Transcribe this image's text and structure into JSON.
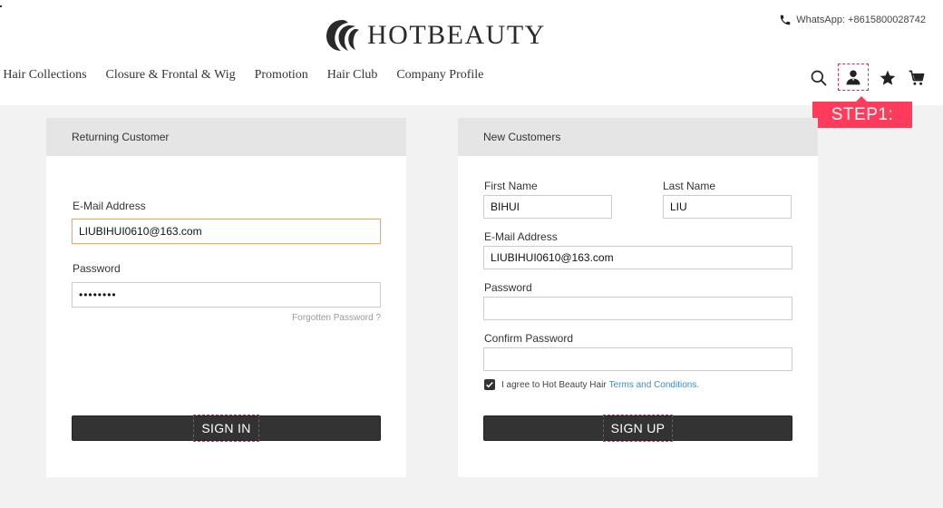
{
  "header": {
    "logo_text": "HOTBEAUTY",
    "whatsapp": "WhatsApp: +8615800028742",
    "nav": [
      "l Hair Collections",
      "Closure & Frontal & Wig",
      "Promotion",
      "Hair Club",
      "Company Profile"
    ],
    "icons": [
      "search-icon",
      "user-icon",
      "star-icon",
      "cart-icon"
    ]
  },
  "step_tip": "STEP1:",
  "sign_in": {
    "title": "Returning Customer",
    "email_label": "E-Mail Address",
    "email_value": "LIUBIHUI0610@163.com",
    "password_label": "Password",
    "password_value": "••••••••",
    "forgot_label": "Forgotten Password ?",
    "button_label": "SIGN IN"
  },
  "sign_up": {
    "title": "New Customers",
    "first_name_label": "First Name",
    "first_name_value": "BIHUI",
    "last_name_label": "Last Name",
    "last_name_value": "LIU",
    "email_label": "E-Mail Address",
    "email_value": "LIUBIHUI0610@163.com",
    "password_label": "Password",
    "password_value": "",
    "confirm_label": "Confirm Password",
    "confirm_value": "",
    "agree_text": "I agree to Hot Beauty Hair",
    "terms_link": "Terms and Conditions.",
    "agree_checked": true,
    "button_label": "SIGN UP"
  },
  "colors": {
    "accent": "#ff3b5c",
    "button": "#333333",
    "focus_border": "#f3a955",
    "link": "#3a8bcd"
  }
}
